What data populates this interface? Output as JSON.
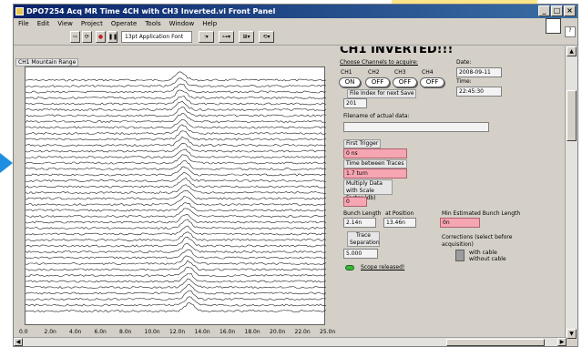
{
  "window": {
    "title": "DPO7254 Acq MR Time 4CH with CH3 Inverted.vi Front Panel",
    "controls": [
      "_",
      "□",
      "×"
    ]
  },
  "menu": [
    "File",
    "Edit",
    "View",
    "Project",
    "Operate",
    "Tools",
    "Window",
    "Help"
  ],
  "toolbar": {
    "font_select": "13pt Application Font",
    "buttons": [
      "⇨",
      "⟳",
      "●",
      "❚❚",
      "⫶▾",
      "⊶▾",
      "⊞▾",
      "⟲▾"
    ]
  },
  "panel": {
    "heading": "CH1 INVERTED!!!",
    "graph_label": "CH1 Mountain Range",
    "x_ticks": [
      "0.0",
      "2.0n",
      "4.0n",
      "6.0n",
      "8.0n",
      "10.0n",
      "12.0n",
      "14.0n",
      "16.0n",
      "18.0n",
      "20.0n",
      "22.0n",
      "25.0n"
    ],
    "choose_channels_label": "Choose Channels to acquire:",
    "channels": [
      {
        "name": "CH1",
        "state": "ON"
      },
      {
        "name": "CH2",
        "state": "OFF"
      },
      {
        "name": "CH3",
        "state": "OFF"
      },
      {
        "name": "CH4",
        "state": "OFF"
      }
    ],
    "date_label": "Date:",
    "date_value": "2008-09-11",
    "time_label": "Time:",
    "time_value": "22:45:30",
    "file_index_label": "File Index for next Save",
    "file_index_value": "201",
    "filename_label": "Filename of actual data:",
    "filename_value": "",
    "first_trigger_label": "First Trigger",
    "first_trigger_value": "0 ns",
    "time_between_label": "Time between Traces",
    "time_between_value": "1.7 turn",
    "multiply_label": "Multiply Data with Scale Factor (db)",
    "multiply_value": "0",
    "bunch_length_label": "Bunch Length",
    "bunch_length_value": "2.14n",
    "at_position_label": "at Position",
    "at_position_value": "13.46n",
    "min_bunch_label": "Min Estimated Bunch Length",
    "min_bunch_value": "0n",
    "trace_sep_label": "Trace Separation",
    "trace_sep_value": "5.000",
    "corrections_label": "Corrections (select before acquisition)",
    "with_cable_label": "with cable",
    "without_cable_label": "without cable",
    "scope_released_label": "Scope released!"
  },
  "chart_data": {
    "type": "line",
    "title": "CH1 Mountain Range",
    "xlabel": "",
    "ylabel": "",
    "x_range": [
      0,
      25
    ],
    "x_tick_labels": [
      "0.0",
      "2.0n",
      "4.0n",
      "6.0n",
      "8.0n",
      "10.0n",
      "12.0n",
      "14.0n",
      "16.0n",
      "18.0n",
      "20.0n",
      "22.0n",
      "25.0n"
    ],
    "trace_count": 40,
    "description": "waterfall of stacked noisy traces with a single pulse near 13.5n drifting slightly",
    "peak_center": 13.5,
    "grid": false
  },
  "colors": {
    "titlebar_start": "#0a246a",
    "titlebar_end": "#3a6ea5",
    "panel_bg": "#d4d0c8",
    "pink_indicator": "#f6a6b2",
    "led_green": "#3cb43c",
    "callout": "#fbe58a",
    "arrow": "#1e8fe0"
  }
}
